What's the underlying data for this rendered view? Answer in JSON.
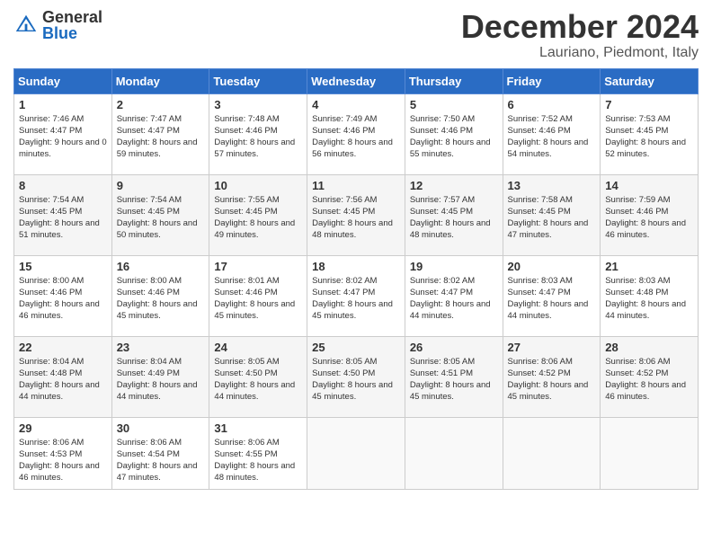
{
  "header": {
    "logo_general": "General",
    "logo_blue": "Blue",
    "month_title": "December 2024",
    "location": "Lauriano, Piedmont, Italy"
  },
  "weekdays": [
    "Sunday",
    "Monday",
    "Tuesday",
    "Wednesday",
    "Thursday",
    "Friday",
    "Saturday"
  ],
  "weeks": [
    [
      {
        "day": "1",
        "sunrise": "Sunrise: 7:46 AM",
        "sunset": "Sunset: 4:47 PM",
        "daylight": "Daylight: 9 hours and 0 minutes."
      },
      {
        "day": "2",
        "sunrise": "Sunrise: 7:47 AM",
        "sunset": "Sunset: 4:47 PM",
        "daylight": "Daylight: 8 hours and 59 minutes."
      },
      {
        "day": "3",
        "sunrise": "Sunrise: 7:48 AM",
        "sunset": "Sunset: 4:46 PM",
        "daylight": "Daylight: 8 hours and 57 minutes."
      },
      {
        "day": "4",
        "sunrise": "Sunrise: 7:49 AM",
        "sunset": "Sunset: 4:46 PM",
        "daylight": "Daylight: 8 hours and 56 minutes."
      },
      {
        "day": "5",
        "sunrise": "Sunrise: 7:50 AM",
        "sunset": "Sunset: 4:46 PM",
        "daylight": "Daylight: 8 hours and 55 minutes."
      },
      {
        "day": "6",
        "sunrise": "Sunrise: 7:52 AM",
        "sunset": "Sunset: 4:46 PM",
        "daylight": "Daylight: 8 hours and 54 minutes."
      },
      {
        "day": "7",
        "sunrise": "Sunrise: 7:53 AM",
        "sunset": "Sunset: 4:45 PM",
        "daylight": "Daylight: 8 hours and 52 minutes."
      }
    ],
    [
      {
        "day": "8",
        "sunrise": "Sunrise: 7:54 AM",
        "sunset": "Sunset: 4:45 PM",
        "daylight": "Daylight: 8 hours and 51 minutes."
      },
      {
        "day": "9",
        "sunrise": "Sunrise: 7:54 AM",
        "sunset": "Sunset: 4:45 PM",
        "daylight": "Daylight: 8 hours and 50 minutes."
      },
      {
        "day": "10",
        "sunrise": "Sunrise: 7:55 AM",
        "sunset": "Sunset: 4:45 PM",
        "daylight": "Daylight: 8 hours and 49 minutes."
      },
      {
        "day": "11",
        "sunrise": "Sunrise: 7:56 AM",
        "sunset": "Sunset: 4:45 PM",
        "daylight": "Daylight: 8 hours and 48 minutes."
      },
      {
        "day": "12",
        "sunrise": "Sunrise: 7:57 AM",
        "sunset": "Sunset: 4:45 PM",
        "daylight": "Daylight: 8 hours and 48 minutes."
      },
      {
        "day": "13",
        "sunrise": "Sunrise: 7:58 AM",
        "sunset": "Sunset: 4:45 PM",
        "daylight": "Daylight: 8 hours and 47 minutes."
      },
      {
        "day": "14",
        "sunrise": "Sunrise: 7:59 AM",
        "sunset": "Sunset: 4:46 PM",
        "daylight": "Daylight: 8 hours and 46 minutes."
      }
    ],
    [
      {
        "day": "15",
        "sunrise": "Sunrise: 8:00 AM",
        "sunset": "Sunset: 4:46 PM",
        "daylight": "Daylight: 8 hours and 46 minutes."
      },
      {
        "day": "16",
        "sunrise": "Sunrise: 8:00 AM",
        "sunset": "Sunset: 4:46 PM",
        "daylight": "Daylight: 8 hours and 45 minutes."
      },
      {
        "day": "17",
        "sunrise": "Sunrise: 8:01 AM",
        "sunset": "Sunset: 4:46 PM",
        "daylight": "Daylight: 8 hours and 45 minutes."
      },
      {
        "day": "18",
        "sunrise": "Sunrise: 8:02 AM",
        "sunset": "Sunset: 4:47 PM",
        "daylight": "Daylight: 8 hours and 45 minutes."
      },
      {
        "day": "19",
        "sunrise": "Sunrise: 8:02 AM",
        "sunset": "Sunset: 4:47 PM",
        "daylight": "Daylight: 8 hours and 44 minutes."
      },
      {
        "day": "20",
        "sunrise": "Sunrise: 8:03 AM",
        "sunset": "Sunset: 4:47 PM",
        "daylight": "Daylight: 8 hours and 44 minutes."
      },
      {
        "day": "21",
        "sunrise": "Sunrise: 8:03 AM",
        "sunset": "Sunset: 4:48 PM",
        "daylight": "Daylight: 8 hours and 44 minutes."
      }
    ],
    [
      {
        "day": "22",
        "sunrise": "Sunrise: 8:04 AM",
        "sunset": "Sunset: 4:48 PM",
        "daylight": "Daylight: 8 hours and 44 minutes."
      },
      {
        "day": "23",
        "sunrise": "Sunrise: 8:04 AM",
        "sunset": "Sunset: 4:49 PM",
        "daylight": "Daylight: 8 hours and 44 minutes."
      },
      {
        "day": "24",
        "sunrise": "Sunrise: 8:05 AM",
        "sunset": "Sunset: 4:50 PM",
        "daylight": "Daylight: 8 hours and 44 minutes."
      },
      {
        "day": "25",
        "sunrise": "Sunrise: 8:05 AM",
        "sunset": "Sunset: 4:50 PM",
        "daylight": "Daylight: 8 hours and 45 minutes."
      },
      {
        "day": "26",
        "sunrise": "Sunrise: 8:05 AM",
        "sunset": "Sunset: 4:51 PM",
        "daylight": "Daylight: 8 hours and 45 minutes."
      },
      {
        "day": "27",
        "sunrise": "Sunrise: 8:06 AM",
        "sunset": "Sunset: 4:52 PM",
        "daylight": "Daylight: 8 hours and 45 minutes."
      },
      {
        "day": "28",
        "sunrise": "Sunrise: 8:06 AM",
        "sunset": "Sunset: 4:52 PM",
        "daylight": "Daylight: 8 hours and 46 minutes."
      }
    ],
    [
      {
        "day": "29",
        "sunrise": "Sunrise: 8:06 AM",
        "sunset": "Sunset: 4:53 PM",
        "daylight": "Daylight: 8 hours and 46 minutes."
      },
      {
        "day": "30",
        "sunrise": "Sunrise: 8:06 AM",
        "sunset": "Sunset: 4:54 PM",
        "daylight": "Daylight: 8 hours and 47 minutes."
      },
      {
        "day": "31",
        "sunrise": "Sunrise: 8:06 AM",
        "sunset": "Sunset: 4:55 PM",
        "daylight": "Daylight: 8 hours and 48 minutes."
      },
      null,
      null,
      null,
      null
    ]
  ]
}
